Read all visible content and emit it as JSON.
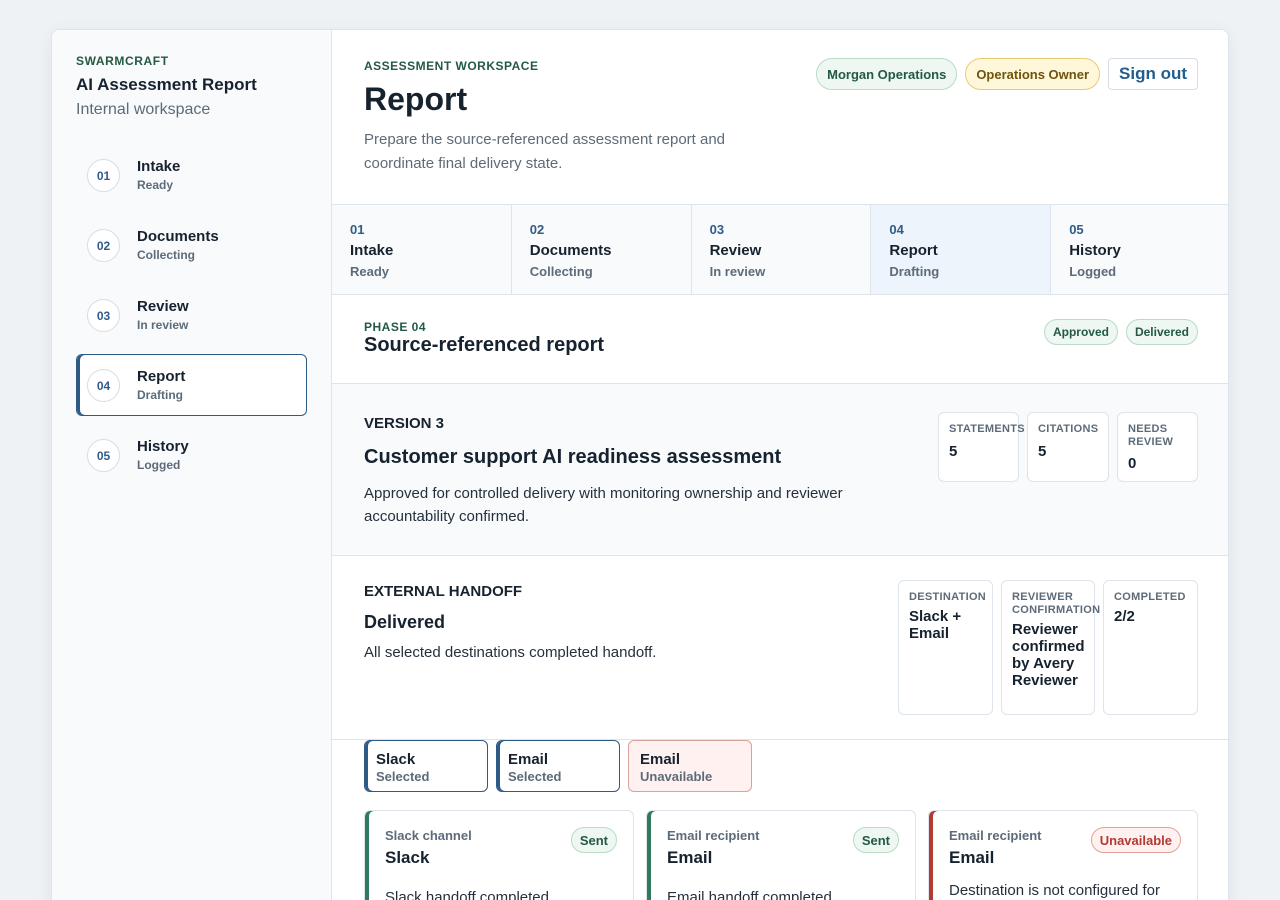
{
  "sidebar": {
    "brand": "SWARMCRAFT",
    "title": "AI Assessment Report",
    "subtitle": "Internal workspace",
    "items": [
      {
        "num": "01",
        "label": "Intake",
        "status": "Ready"
      },
      {
        "num": "02",
        "label": "Documents",
        "status": "Collecting"
      },
      {
        "num": "03",
        "label": "Review",
        "status": "In review"
      },
      {
        "num": "04",
        "label": "Report",
        "status": "Drafting"
      },
      {
        "num": "05",
        "label": "History",
        "status": "Logged"
      }
    ]
  },
  "header": {
    "eyebrow": "ASSESSMENT WORKSPACE",
    "title": "Report",
    "description": "Prepare the source-referenced assessment report and coordinate final delivery state.",
    "user": "Morgan Operations",
    "role": "Operations Owner",
    "sign_out": "Sign out"
  },
  "phase_tabs": [
    {
      "num": "01",
      "label": "Intake",
      "status": "Ready"
    },
    {
      "num": "02",
      "label": "Documents",
      "status": "Collecting"
    },
    {
      "num": "03",
      "label": "Review",
      "status": "In review"
    },
    {
      "num": "04",
      "label": "Report",
      "status": "Drafting"
    },
    {
      "num": "05",
      "label": "History",
      "status": "Logged"
    }
  ],
  "phase": {
    "eyebrow": "PHASE 04",
    "title": "Source-referenced report",
    "badges": [
      "Approved",
      "Delivered"
    ]
  },
  "version": {
    "label": "VERSION 3",
    "title": "Customer support AI readiness assessment",
    "description": "Approved for controlled delivery with monitoring ownership and reviewer accountability confirmed.",
    "metrics": [
      {
        "label": "STATEMENTS",
        "value": "5"
      },
      {
        "label": "CITATIONS",
        "value": "5"
      },
      {
        "label": "NEEDS REVIEW",
        "value": "0"
      }
    ]
  },
  "handoff": {
    "label": "EXTERNAL HANDOFF",
    "state": "Delivered",
    "description": "All selected destinations completed handoff.",
    "metrics": [
      {
        "label": "DESTINATION",
        "value": "Slack + Email"
      },
      {
        "label_line1": "REVIEWER",
        "label_line2": "CONFIRMATION",
        "value": "Reviewer confirmed by Avery Reviewer"
      },
      {
        "label": "COMPLETED",
        "value": "2/2"
      }
    ]
  },
  "destinations": [
    {
      "label": "Slack",
      "status": "Selected"
    },
    {
      "label": "Email",
      "status": "Selected"
    },
    {
      "label": "Email",
      "status": "Unavailable"
    }
  ],
  "delivery_cards": [
    {
      "kind": "Slack channel",
      "title": "Slack",
      "badge": "Sent",
      "description": "Slack handoff completed."
    },
    {
      "kind": "Email recipient",
      "title": "Email",
      "badge": "Sent",
      "description": "Email handoff completed."
    },
    {
      "kind": "Email recipient",
      "title": "Email",
      "badge": "Unavailable",
      "description": "Destination is not configured for"
    }
  ]
}
